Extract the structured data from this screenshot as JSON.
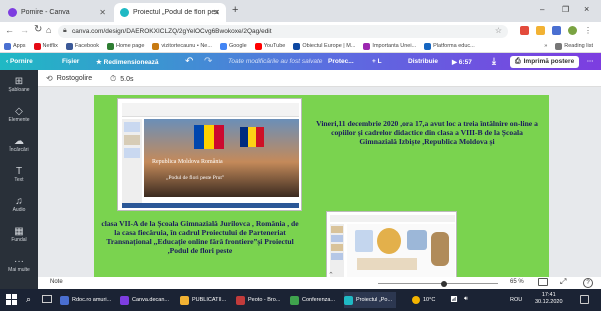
{
  "browser": {
    "tabs": [
      {
        "label": "Pomire - Canva",
        "active": false,
        "favicon_color": "#7d3de0"
      },
      {
        "label": "Proiectul „Podul de flori peste Prut",
        "active": true,
        "favicon_color": "#1fb9c4"
      }
    ],
    "new_tab_symbol": "+",
    "window_controls": [
      "–",
      "❐",
      "×"
    ],
    "url": "canva.com/design/DAEROKXICLZQ/2gYelOCvg6Bwokoxe/2Qag/edit",
    "bookmarks": [
      {
        "label": "Apps",
        "color": "#4a6fd1"
      },
      {
        "label": "Netflix",
        "color": "#e50914"
      },
      {
        "label": "Facebook",
        "color": "#3b5998"
      },
      {
        "label": "Home page",
        "color": "#2e7d32"
      },
      {
        "label": "vizitortecaunu • Ne...",
        "color": "#c77a12"
      },
      {
        "label": "Google",
        "color": "#4285f4"
      },
      {
        "label": "YouTube",
        "color": "#ff0000"
      },
      {
        "label": "Obiectul Europe | M...",
        "color": "#0d47a1"
      },
      {
        "label": "Importanta Unei...",
        "color": "#9c27b0"
      },
      {
        "label": "Platforma educ...",
        "color": "#1565c0"
      }
    ],
    "bookmarks_more": "»",
    "reading_list": "Reading list"
  },
  "canva_toolbar": {
    "back_label": "‹  Pornire",
    "file_label": "Fișier",
    "resize_label": "★ Redimensionează",
    "undo": "↶",
    "redo": "↷",
    "save_status": "Toate modificările au fost salvate",
    "title": "Protec...",
    "collab": "+ L",
    "distribute_label": "Distribuie",
    "play_label": "▶ 6:57",
    "download_icon": "⤓",
    "print_label": "Imprimă postere",
    "more": "···"
  },
  "left_panel": [
    {
      "label": "Șabloane",
      "icon": "⊞"
    },
    {
      "label": "Elemente",
      "icon": "◇"
    },
    {
      "label": "Încărcări",
      "icon": "☁"
    },
    {
      "label": "Text",
      "icon": "T"
    },
    {
      "label": "Audio",
      "icon": "♫"
    },
    {
      "label": "Fundal",
      "icon": "▦"
    },
    {
      "label": "Mai multe",
      "icon": "···"
    }
  ],
  "subbar": {
    "rotate_label": "Rostogolire",
    "timer_label": "5.0s"
  },
  "page": {
    "text_right": "Vineri,11 decembrie 2020 ,ora 17,a avut loc a  treia întâlnire on-line a copiilor și cadrelor didactice din clasa a VIII-B  de la Școala Gimnazială Izbiște ,Republica Moldova și",
    "text_left": "clasa VII-A de la Școala Gimnazială Jurilovca , România  , de la casa fiecăruia, în cadrul Proiectului de Parteneriat Transnațional ,,Educație online fără frontiere”și Proiectul  ,Podul de flori peste",
    "slide1_line1": "Republica Moldova  România",
    "slide1_line2": "„Podul de flori peste Prut”",
    "bg_color": "#7ad34f"
  },
  "bottom": {
    "notes_label": "Note",
    "zoom": "65 %",
    "zoom_fraction": 0.55,
    "expand": "⤢",
    "help": "?"
  },
  "taskbar": {
    "items": [
      {
        "label": "Rdoc.ro amuri...",
        "color": "#4a6fd1"
      },
      {
        "label": "Canva.decan...",
        "color": "#7d3de0"
      },
      {
        "label": "PUBLICATII...",
        "color": "#f2b233"
      },
      {
        "label": "Peoto - Bro...",
        "color": "#c13b3b"
      },
      {
        "label": "Conferenza...",
        "color": "#3fa34d"
      },
      {
        "label": "Proiectul „Po...",
        "color": "#1fb9c4"
      }
    ],
    "weather": "10°C",
    "lang": "ROU",
    "time": "17:41",
    "date": "30.12.2020"
  }
}
